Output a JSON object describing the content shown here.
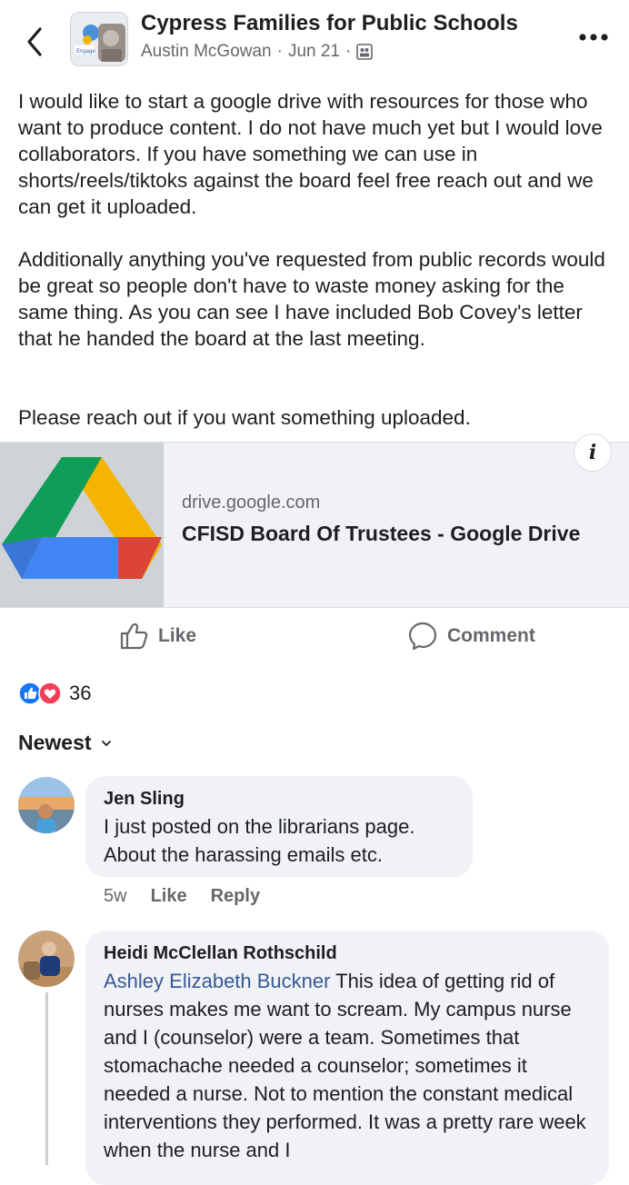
{
  "header": {
    "group_name": "Cypress Families for Public Schools",
    "author": "Austin McGowan",
    "date": "Jun 21",
    "separator": "·",
    "icons": [
      "back-chevron-icon",
      "group-avatar",
      "members-audience-icon",
      "more-dots-icon"
    ]
  },
  "post": {
    "paragraph1": "I would like to start a google drive with resources for those who want to produce content. I do not have much yet but I would love collaborators. If you have something we can use in shorts/reels/tiktoks against the board feel free reach out and we can get it uploaded.",
    "paragraph2": "Additionally anything you've requested from public records would be great so people don't have to waste money asking for the same thing. As you can see I have included Bob Covey's letter that he handed the board at the last meeting.",
    "paragraph3": "Please reach out if you want something uploaded."
  },
  "link_card": {
    "domain": "drive.google.com",
    "title": "CFISD Board Of Trustees - Google Drive",
    "info_glyph": "i"
  },
  "actions": {
    "like": "Like",
    "comment": "Comment"
  },
  "reactions": {
    "count": "36",
    "types": [
      "like",
      "love"
    ],
    "colors": {
      "like": "#1877f2",
      "love": "#f33e58"
    }
  },
  "comments_sort": {
    "label": "Newest"
  },
  "comments": [
    {
      "name": "Jen Sling",
      "text": "I just posted on the librarians page. About the harassing emails etc.",
      "time": "5w",
      "like": "Like",
      "reply": "Reply"
    },
    {
      "name": "Heidi McClellan Rothschild",
      "mention": "Ashley Elizabeth Buckner",
      "text": " This idea of getting rid of nurses makes me want to scream. My campus nurse and I (counselor) were a team. Sometimes that stomachache needed a counselor; sometimes it needed a nurse. Not to mention the constant medical interventions they performed. It was a pretty rare week when the nurse and I"
    }
  ]
}
